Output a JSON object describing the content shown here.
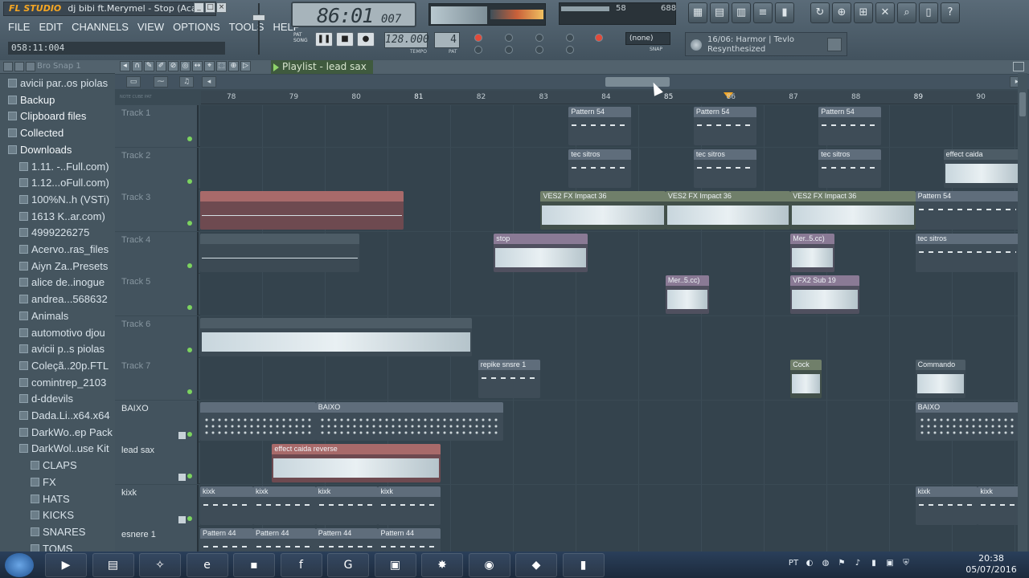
{
  "app": {
    "name": "FL STUDIO",
    "title": "dj bibi ft.Merymel - Stop (Acap..."
  },
  "menu": [
    "FILE",
    "EDIT",
    "CHANNELS",
    "VIEW",
    "OPTIONS",
    "TOOLS",
    "HELP"
  ],
  "clock_text": "058:11:004",
  "lcd": {
    "main": "86:01",
    "sub": "007"
  },
  "cpu": {
    "a": "58",
    "b": "688"
  },
  "tempo": {
    "value": "128.000",
    "label": "TEMPO"
  },
  "pattern": {
    "value": "4",
    "label": "PAT"
  },
  "modes": [
    "PAT",
    "SONG"
  ],
  "snap_select": {
    "value": "(none)",
    "label": "SNAP"
  },
  "hint": {
    "line1": "16/06: Harmor | Tevlo",
    "line2": "Resynthesized"
  },
  "browser": {
    "head": "Bro Snap 1",
    "items": [
      {
        "label": "avicii par..os piolas",
        "indent": 1
      },
      {
        "label": "Backup",
        "indent": 1,
        "top": true
      },
      {
        "label": "Clipboard files",
        "indent": 1,
        "top": true
      },
      {
        "label": "Collected",
        "indent": 1,
        "top": true
      },
      {
        "label": "Downloads",
        "indent": 1,
        "top": true
      },
      {
        "label": "1.11. -..Full.com)",
        "indent": 2
      },
      {
        "label": "1.12...oFull.com)",
        "indent": 2
      },
      {
        "label": "100%N..h (VSTi)",
        "indent": 2
      },
      {
        "label": "1613 K..ar.com)",
        "indent": 2
      },
      {
        "label": "4999226275",
        "indent": 2
      },
      {
        "label": "Acervo..ras_files",
        "indent": 2
      },
      {
        "label": "Aiyn Za..Presets",
        "indent": 2
      },
      {
        "label": "alice de..inogue",
        "indent": 2
      },
      {
        "label": "andrea...568632",
        "indent": 2
      },
      {
        "label": "Animals",
        "indent": 2
      },
      {
        "label": "automotivo djou",
        "indent": 2
      },
      {
        "label": "avicii p..s piolas",
        "indent": 2
      },
      {
        "label": "Coleçã..20p.FTL",
        "indent": 2
      },
      {
        "label": "comintrep_2103",
        "indent": 2
      },
      {
        "label": "d-ddevils",
        "indent": 2
      },
      {
        "label": "Dada.Li..x64.x64",
        "indent": 2
      },
      {
        "label": "DarkWo..ep Pack",
        "indent": 2
      },
      {
        "label": "DarkWol..use Kit",
        "indent": 2
      },
      {
        "label": "CLAPS",
        "indent": 3
      },
      {
        "label": "FX",
        "indent": 3
      },
      {
        "label": "HATS",
        "indent": 3
      },
      {
        "label": "KICKS",
        "indent": 3
      },
      {
        "label": "SNARES",
        "indent": 3
      },
      {
        "label": "TOMS",
        "indent": 3
      }
    ]
  },
  "playlist": {
    "title": "Playlist - lead sax",
    "ruler": [
      "78",
      "79",
      "80",
      "81",
      "82",
      "83",
      "84",
      "85",
      "86",
      "87",
      "88",
      "89",
      "90"
    ],
    "tracks": [
      {
        "name": "Track 1",
        "lit": false,
        "lock": false,
        "clips": [
          {
            "label": "Pattern 54",
            "kind": "p",
            "start": 83.45,
            "len": 1.0,
            "fill": "notes"
          },
          {
            "label": "Pattern 54",
            "kind": "p",
            "start": 85.45,
            "len": 1.0,
            "fill": "notes"
          },
          {
            "label": "Pattern 54",
            "kind": "p",
            "start": 87.45,
            "len": 1.0,
            "fill": "notes"
          }
        ]
      },
      {
        "name": "Track 2",
        "lit": false,
        "lock": false,
        "clips": [
          {
            "label": "tec sitros",
            "kind": "p",
            "start": 83.45,
            "len": 1.0,
            "fill": "notes"
          },
          {
            "label": "tec sitros",
            "kind": "p",
            "start": 85.45,
            "len": 1.0,
            "fill": "notes"
          },
          {
            "label": "tec sitros",
            "kind": "p",
            "start": 87.45,
            "len": 1.0,
            "fill": "notes"
          },
          {
            "label": "effect caida",
            "kind": "k",
            "start": 89.45,
            "len": 1.65,
            "fill": "wave"
          }
        ]
      },
      {
        "name": "Track 3",
        "lit": false,
        "lock": false,
        "clips": [
          {
            "label": "",
            "kind": "r",
            "start": 77.0,
            "len": 3.8,
            "fill": "thin"
          },
          {
            "label": "VES2 FX Impact 36",
            "kind": "a",
            "start": 83.0,
            "len": 2.0,
            "fill": "wave"
          },
          {
            "label": "VES2 FX Impact 36",
            "kind": "a",
            "start": 85.0,
            "len": 2.0,
            "fill": "wave"
          },
          {
            "label": "VES2 FX Impact 36",
            "kind": "a",
            "start": 87.0,
            "len": 2.0,
            "fill": "wave"
          },
          {
            "label": "Pattern 54",
            "kind": "p",
            "start": 89.0,
            "len": 2.0,
            "fill": "notes"
          }
        ]
      },
      {
        "name": "Track 4",
        "lit": false,
        "lock": false,
        "clips": [
          {
            "label": "",
            "kind": "k",
            "start": 77.0,
            "len": 3.1,
            "fill": "thin"
          },
          {
            "label": "stop",
            "kind": "l",
            "start": 82.25,
            "len": 1.5,
            "fill": "wave"
          },
          {
            "label": "Mer..5.cc)",
            "kind": "l",
            "start": 87.0,
            "len": 0.7,
            "fill": "wave"
          },
          {
            "label": "tec sitros",
            "kind": "p",
            "start": 89.0,
            "len": 2.0,
            "fill": "notes"
          }
        ]
      },
      {
        "name": "Track 5",
        "lit": false,
        "lock": false,
        "clips": [
          {
            "label": "Mer..5.cc)",
            "kind": "l",
            "start": 85.0,
            "len": 0.7,
            "fill": "wave"
          },
          {
            "label": "VFX2 Sub 19",
            "kind": "l",
            "start": 87.0,
            "len": 1.1,
            "fill": "wave"
          }
        ]
      },
      {
        "name": "Track 6",
        "lit": false,
        "lock": false,
        "clips": [
          {
            "label": "",
            "kind": "k",
            "start": 77.0,
            "len": 4.9,
            "fill": "wave"
          }
        ]
      },
      {
        "name": "Track 7",
        "lit": false,
        "lock": false,
        "clips": [
          {
            "label": "repike snsre 1",
            "kind": "p",
            "start": 82.0,
            "len": 1.0,
            "fill": "notes"
          },
          {
            "label": "Cock",
            "kind": "a",
            "start": 87.0,
            "len": 0.5,
            "fill": "wave"
          },
          {
            "label": "Commando",
            "kind": "k",
            "start": 89.0,
            "len": 0.8,
            "fill": "wave"
          }
        ]
      },
      {
        "name": "BAIXO",
        "lit": true,
        "lock": true,
        "clips": [
          {
            "label": "",
            "kind": "p",
            "start": 77.0,
            "len": 2.4,
            "fill": "dots"
          },
          {
            "label": "BAIXO",
            "kind": "p",
            "start": 79.4,
            "len": 3.0,
            "fill": "dots"
          },
          {
            "label": "BAIXO",
            "kind": "p",
            "start": 89.0,
            "len": 2.0,
            "fill": "dots"
          }
        ]
      },
      {
        "name": "lead sax",
        "lit": true,
        "lock": true,
        "clips": [
          {
            "label": "effect caida reverse",
            "kind": "r",
            "start": 78.7,
            "len": 2.7,
            "fill": "wave"
          }
        ]
      },
      {
        "name": "kixk",
        "lit": true,
        "lock": true,
        "clips": [
          {
            "label": "",
            "kind": "p",
            "start": 77.0,
            "len": 0.4,
            "fill": "notes"
          },
          {
            "label": "kixk",
            "kind": "p",
            "start": 77.4,
            "len": 1.0,
            "fill": "notes"
          },
          {
            "label": "kixk",
            "kind": "p",
            "start": 78.4,
            "len": 1.0,
            "fill": "notes"
          },
          {
            "label": "kixk",
            "kind": "p",
            "start": 79.4,
            "len": 1.0,
            "fill": "notes"
          },
          {
            "label": "kixk",
            "kind": "p",
            "start": 80.4,
            "len": 1.0,
            "fill": "notes"
          },
          {
            "label": "kixk",
            "kind": "p",
            "start": 89.0,
            "len": 1.0,
            "fill": "notes"
          },
          {
            "label": "kixk",
            "kind": "p",
            "start": 90.0,
            "len": 0.7,
            "fill": "notes"
          }
        ]
      },
      {
        "name": "esnere 1",
        "lit": true,
        "lock": false,
        "clips": [
          {
            "label": "44",
            "kind": "p",
            "start": 77.0,
            "len": 0.4,
            "fill": "notes"
          },
          {
            "label": "Pattern 44",
            "kind": "p",
            "start": 77.4,
            "len": 1.0,
            "fill": "notes"
          },
          {
            "label": "Pattern 44",
            "kind": "p",
            "start": 78.4,
            "len": 1.0,
            "fill": "notes"
          },
          {
            "label": "Pattern 44",
            "kind": "p",
            "start": 79.4,
            "len": 1.0,
            "fill": "notes"
          },
          {
            "label": "Pattern 44",
            "kind": "p",
            "start": 80.4,
            "len": 1.0,
            "fill": "notes"
          }
        ]
      }
    ]
  },
  "taskbar": {
    "apps": [
      "media-player",
      "file-explorer",
      "tool",
      "internet-explorer",
      "terminal",
      "facebook",
      "browser-g",
      "computer",
      "game",
      "chrome",
      "fl-studio",
      "presentation"
    ],
    "lang": "PT",
    "time": "20:38",
    "date": "05/07/2016"
  }
}
